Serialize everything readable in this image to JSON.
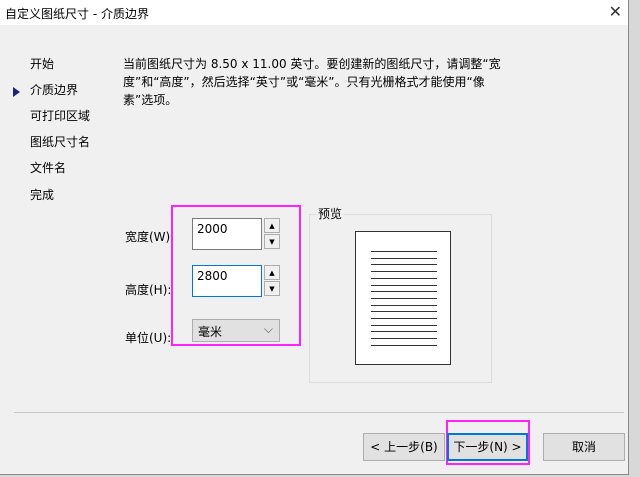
{
  "window": {
    "title": "自定义图纸尺寸 - 介质边界",
    "close_icon": "close-icon"
  },
  "sidebar": {
    "items": [
      {
        "label": "开始"
      },
      {
        "label": "介质边界",
        "current": true
      },
      {
        "label": "可打印区域"
      },
      {
        "label": "图纸尺寸名"
      },
      {
        "label": "文件名"
      },
      {
        "label": "完成"
      }
    ]
  },
  "main": {
    "description": "当前图纸尺寸为 8.50 x 11.00 英寸。要创建新的图纸尺寸，请调整“宽度”和“高度”，然后选择“英寸”或“毫米”。只有光栅格式才能使用“像素”选项。",
    "width": {
      "label": "宽度(W):",
      "value": "2000"
    },
    "height": {
      "label": "高度(H):",
      "value": "2800"
    },
    "unit": {
      "label": "单位(U):",
      "value": "毫米"
    },
    "preview": {
      "label": "预览"
    }
  },
  "footer": {
    "back": "< 上一步(B)",
    "next": "下一步(N) >",
    "cancel": "取消"
  },
  "colors": {
    "highlight": "#ff22ff",
    "accent": "#0078d7"
  }
}
